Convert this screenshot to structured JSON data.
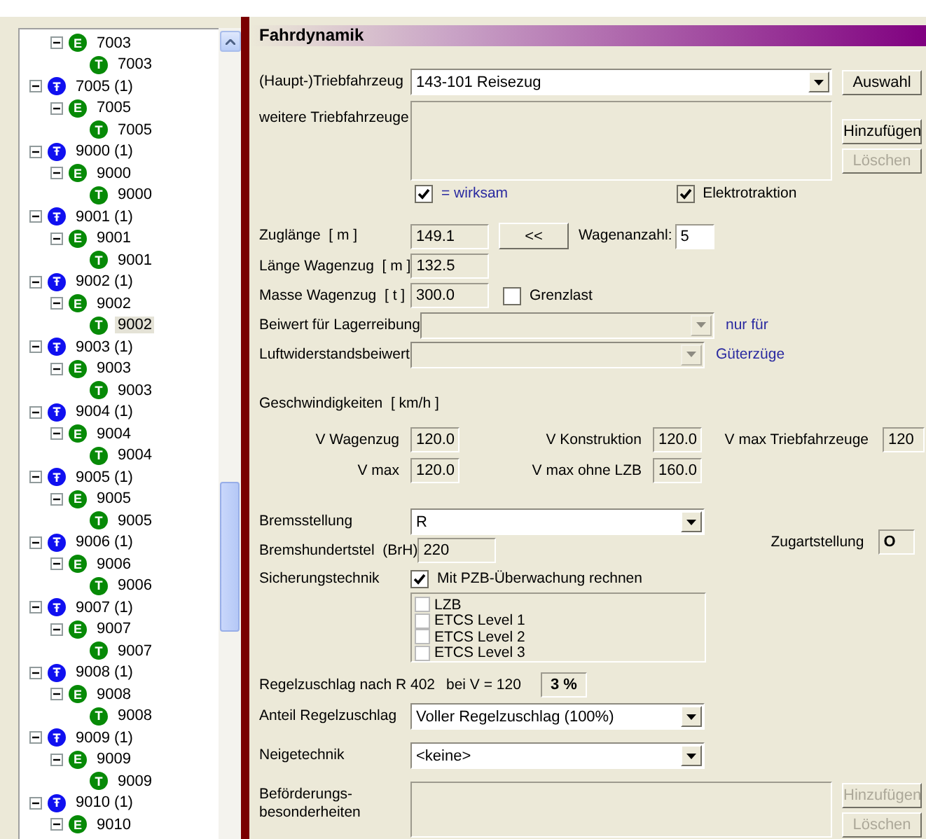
{
  "tree": [
    {
      "children": [
        {
          "kind": "engine",
          "badge": "E",
          "label": "7003",
          "expanded": true,
          "selected": false,
          "children": [
            {
              "kind": "train",
              "badge": "T",
              "label": "7003",
              "selected": false
            }
          ]
        }
      ]
    },
    {
      "kind": "group",
      "badge": "Ŧ",
      "label": "7005 (1)",
      "expanded": true,
      "selected": false,
      "children": [
        {
          "kind": "engine",
          "badge": "E",
          "label": "7005",
          "expanded": true,
          "selected": false,
          "children": [
            {
              "kind": "train",
              "badge": "T",
              "label": "7005",
              "selected": false
            }
          ]
        }
      ]
    },
    {
      "kind": "group",
      "badge": "Ŧ",
      "label": "9000 (1)",
      "expanded": true,
      "selected": false,
      "children": [
        {
          "kind": "engine",
          "badge": "E",
          "label": "9000",
          "expanded": true,
          "selected": false,
          "children": [
            {
              "kind": "train",
              "badge": "T",
              "label": "9000",
              "selected": false
            }
          ]
        }
      ]
    },
    {
      "kind": "group",
      "badge": "Ŧ",
      "label": "9001 (1)",
      "expanded": true,
      "selected": false,
      "children": [
        {
          "kind": "engine",
          "badge": "E",
          "label": "9001",
          "expanded": true,
          "selected": false,
          "children": [
            {
              "kind": "train",
              "badge": "T",
              "label": "9001",
              "selected": false
            }
          ]
        }
      ]
    },
    {
      "kind": "group",
      "badge": "Ŧ",
      "label": "9002 (1)",
      "expanded": true,
      "selected": false,
      "children": [
        {
          "kind": "engine",
          "badge": "E",
          "label": "9002",
          "expanded": true,
          "selected": false,
          "children": [
            {
              "kind": "train",
              "badge": "T",
              "label": "9002",
              "selected": true
            }
          ]
        }
      ]
    },
    {
      "kind": "group",
      "badge": "Ŧ",
      "label": "9003 (1)",
      "expanded": true,
      "selected": false,
      "children": [
        {
          "kind": "engine",
          "badge": "E",
          "label": "9003",
          "expanded": true,
          "selected": false,
          "children": [
            {
              "kind": "train",
              "badge": "T",
              "label": "9003",
              "selected": false
            }
          ]
        }
      ]
    },
    {
      "kind": "group",
      "badge": "Ŧ",
      "label": "9004 (1)",
      "expanded": true,
      "selected": false,
      "children": [
        {
          "kind": "engine",
          "badge": "E",
          "label": "9004",
          "expanded": true,
          "selected": false,
          "children": [
            {
              "kind": "train",
              "badge": "T",
              "label": "9004",
              "selected": false
            }
          ]
        }
      ]
    },
    {
      "kind": "group",
      "badge": "Ŧ",
      "label": "9005 (1)",
      "expanded": true,
      "selected": false,
      "children": [
        {
          "kind": "engine",
          "badge": "E",
          "label": "9005",
          "expanded": true,
          "selected": false,
          "children": [
            {
              "kind": "train",
              "badge": "T",
              "label": "9005",
              "selected": false
            }
          ]
        }
      ]
    },
    {
      "kind": "group",
      "badge": "Ŧ",
      "label": "9006 (1)",
      "expanded": true,
      "selected": false,
      "children": [
        {
          "kind": "engine",
          "badge": "E",
          "label": "9006",
          "expanded": true,
          "selected": false,
          "children": [
            {
              "kind": "train",
              "badge": "T",
              "label": "9006",
              "selected": false
            }
          ]
        }
      ]
    },
    {
      "kind": "group",
      "badge": "Ŧ",
      "label": "9007 (1)",
      "expanded": true,
      "selected": false,
      "children": [
        {
          "kind": "engine",
          "badge": "E",
          "label": "9007",
          "expanded": true,
          "selected": false,
          "children": [
            {
              "kind": "train",
              "badge": "T",
              "label": "9007",
              "selected": false
            }
          ]
        }
      ]
    },
    {
      "kind": "group",
      "badge": "Ŧ",
      "label": "9008 (1)",
      "expanded": true,
      "selected": false,
      "children": [
        {
          "kind": "engine",
          "badge": "E",
          "label": "9008",
          "expanded": true,
          "selected": false,
          "children": [
            {
              "kind": "train",
              "badge": "T",
              "label": "9008",
              "selected": false
            }
          ]
        }
      ]
    },
    {
      "kind": "group",
      "badge": "Ŧ",
      "label": "9009 (1)",
      "expanded": true,
      "selected": false,
      "children": [
        {
          "kind": "engine",
          "badge": "E",
          "label": "9009",
          "expanded": true,
          "selected": false,
          "children": [
            {
              "kind": "train",
              "badge": "T",
              "label": "9009",
              "selected": false
            }
          ]
        }
      ]
    },
    {
      "kind": "group",
      "badge": "Ŧ",
      "label": "9010 (1)",
      "expanded": true,
      "selected": false,
      "children": [
        {
          "kind": "engine",
          "badge": "E",
          "label": "9010",
          "expanded": true,
          "selected": false
        }
      ]
    }
  ],
  "form": {
    "title": "Fahrdynamik",
    "main_vehicle": {
      "label": "(Haupt-)Triebfahrzeug",
      "value": "143-101 Reisezug",
      "button": {
        "label": "Auswahl",
        "disabled": false
      }
    },
    "more_vehicles": {
      "label": "weitere Triebfahrzeuge",
      "add_button": {
        "label": "Hinzufügen",
        "disabled": false
      },
      "delete_button": {
        "label": "Löschen",
        "disabled": true
      }
    },
    "legend": {
      "label": "= wirksam",
      "checked": true
    },
    "electric": {
      "label": "Elektrotraktion",
      "checked": true
    },
    "train_length": {
      "label": "Zuglänge  [ m ]",
      "value": "149.1",
      "button": "<<"
    },
    "wagon_count": {
      "label": "Wagenanzahl:",
      "value": "5"
    },
    "wagon_length": {
      "label": "Länge Wagenzug  [ m ]",
      "value": "132.5"
    },
    "wagon_mass": {
      "label": "Masse Wagenzug  [ t ]",
      "value": "300.0"
    },
    "limit_load": {
      "label": "Grenzlast",
      "checked": false
    },
    "bearing_friction": {
      "label": "Beiwert für Lagerreibung",
      "disabled": true,
      "note": "nur für"
    },
    "air_resistance": {
      "label": "Luftwiderstandsbeiwert",
      "disabled": true,
      "note": "Güterzüge"
    },
    "speeds_title": "Geschwindigkeiten  [ km/h ]",
    "speed_rows": [
      [
        {
          "label": "V Wagenzug",
          "value": "120.0"
        },
        {
          "label": "V Konstruktion",
          "value": "120.0"
        },
        {
          "label": "V max Triebfahrzeuge",
          "value": "120"
        }
      ],
      [
        {
          "label": "V max",
          "value": "120.0"
        },
        {
          "label": "V max ohne LZB",
          "value": "160.0"
        }
      ]
    ],
    "brake": {
      "label": "Bremsstellung",
      "value": "R"
    },
    "brake_percent": {
      "label": "Bremshundertstel  (BrH)",
      "value": "220"
    },
    "train_type": {
      "label": "Zugartstellung",
      "value": "O"
    },
    "safety": {
      "label": "Sicherungstechnik",
      "pzb": {
        "label": "Mit PZB-Überwachung rechnen",
        "checked": true
      },
      "systems": [
        {
          "label": "LZB",
          "checked": false
        },
        {
          "label": "ETCS Level 1",
          "checked": false
        },
        {
          "label": "ETCS Level 2",
          "checked": false
        },
        {
          "label": "ETCS Level 3",
          "checked": false
        }
      ]
    },
    "surcharge": {
      "label": "Regelzuschlag nach R 402",
      "speed": "bei V = 120",
      "value": "3 %"
    },
    "surcharge_share": {
      "label": "Anteil Regelzuschlag",
      "value": "Voller Regelzuschlag (100%)"
    },
    "tilt": {
      "label": "Neigetechnik",
      "value": "<keine>"
    },
    "transport": {
      "label": "Beförderungs-\nbesonderheiten",
      "add_button": {
        "label": "Hinzufügen",
        "disabled": true
      },
      "delete_button": {
        "label": "Löschen",
        "disabled": true
      }
    }
  }
}
